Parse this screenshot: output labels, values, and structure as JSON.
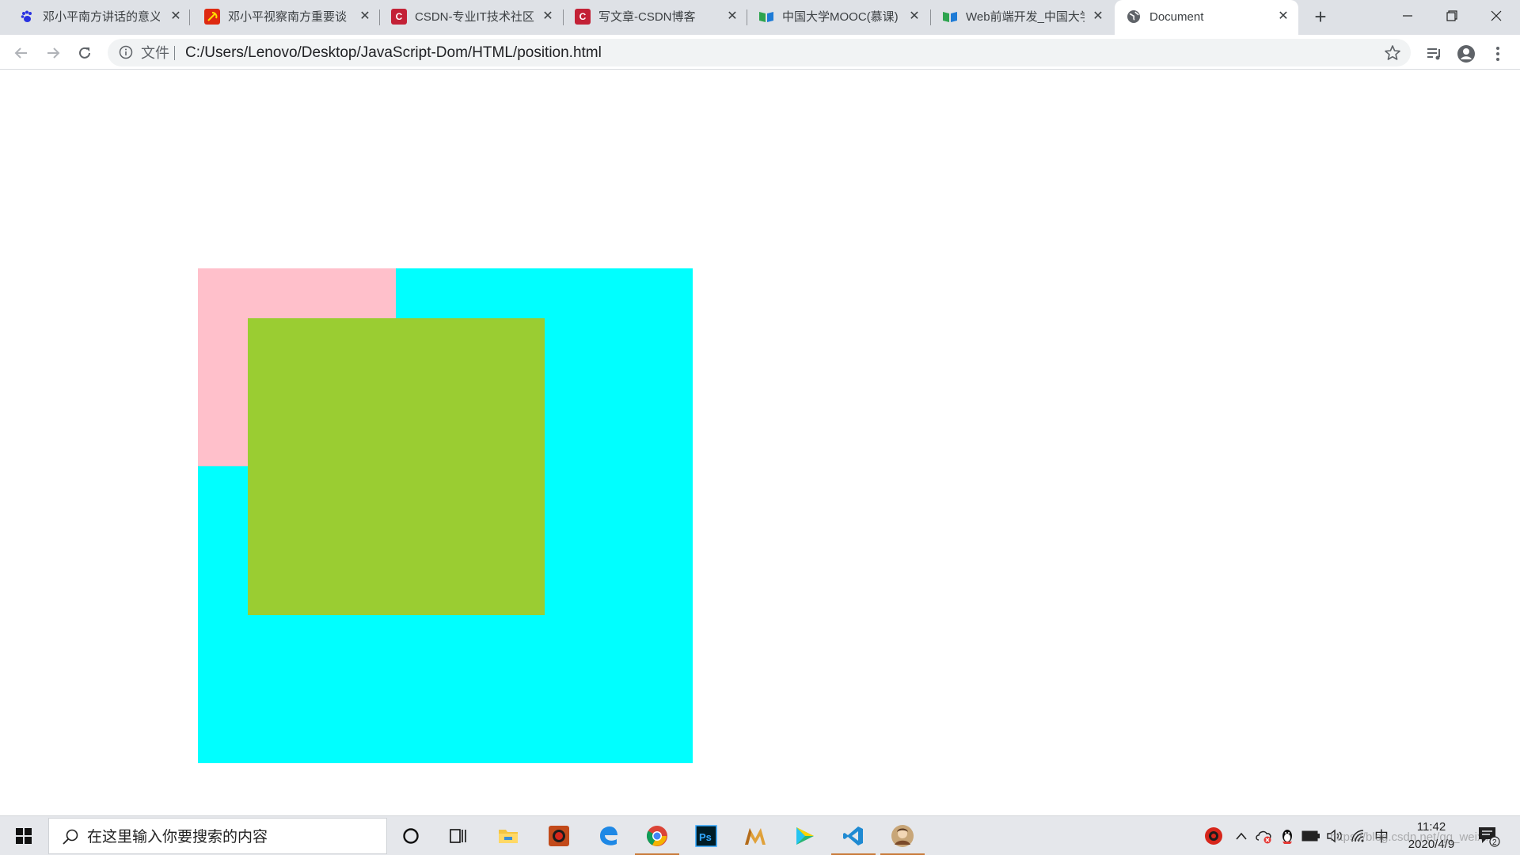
{
  "browser": {
    "tabs": [
      {
        "title": "邓小平南方讲话的意义",
        "favicon": "baidu-paw-icon",
        "color": "#2932e1",
        "active": false
      },
      {
        "title": "邓小平视察南方重要谈",
        "favicon": "party-emblem-icon",
        "color": "#de2910",
        "active": false
      },
      {
        "title": "CSDN-专业IT技术社区",
        "favicon": "csdn-icon",
        "color": "#c32136",
        "active": false
      },
      {
        "title": "写文章-CSDN博客",
        "favicon": "csdn-icon",
        "color": "#c32136",
        "active": false
      },
      {
        "title": "中国大学MOOC(慕课)",
        "favicon": "mooc-book-icon",
        "color": "#2ea44f",
        "active": false
      },
      {
        "title": "Web前端开发_中国大学",
        "favicon": "mooc-book-icon",
        "color": "#2ea44f",
        "active": false
      },
      {
        "title": "Document",
        "favicon": "globe-icon",
        "color": "#5f6368",
        "active": true
      }
    ],
    "close_glyph": "✕",
    "new_tab_glyph": "+",
    "window_controls": {
      "minimize": "—",
      "restore": "❐",
      "close": "✕"
    }
  },
  "toolbar": {
    "file_label": "文件",
    "url": "C:/Users/Lenovo/Desktop/JavaScript-Dom/HTML/position.html"
  },
  "page": {
    "boxes": [
      {
        "name": "cyan-box",
        "color": "#00ffff"
      },
      {
        "name": "pink-box",
        "color": "#ffc0cb"
      },
      {
        "name": "green-box",
        "color": "#9acd32"
      }
    ]
  },
  "taskbar": {
    "search_placeholder": "在这里输入你要搜索的内容",
    "pinned_apps": [
      "cortana-icon",
      "task-view-icon",
      "file-explorer-icon",
      "wps-icon",
      "edge-icon",
      "chrome-icon",
      "photoshop-icon",
      "maya-icon",
      "video-player-icon",
      "vscode-icon",
      "avatar-app-icon"
    ],
    "ps_label": "Ps",
    "ime": "中",
    "time": "11:42",
    "date": "2020/4/9",
    "notification_count": "2",
    "watermark": "https://blog.csdn.net/qq_weixin"
  }
}
